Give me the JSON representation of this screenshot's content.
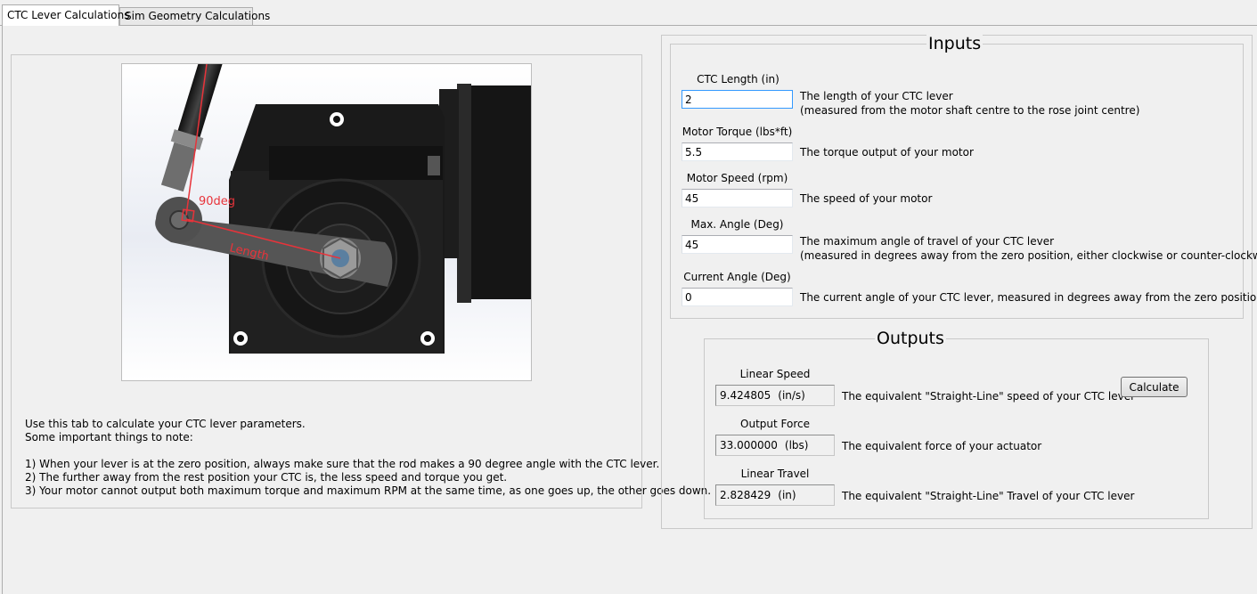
{
  "tabs": [
    {
      "label": "CTC Lever Calculations",
      "active": true
    },
    {
      "label": "Sim Geometry Calculations",
      "active": false
    }
  ],
  "diagram": {
    "angle_label": "90deg",
    "length_label": "Length",
    "annotation_color": "#e8333a"
  },
  "notes": {
    "intro_1": "Use this tab to calculate your CTC lever parameters.",
    "intro_2": "Some important things to note:",
    "point_1": "1) When your lever is at the zero position, always make sure that the rod makes a 90 degree angle with the CTC lever.",
    "point_2": "2) The further away from the rest position your CTC is, the less speed and torque you get.",
    "point_3": "3) Your motor cannot output both maximum torque and maximum RPM at the same time, as one goes up, the other goes down."
  },
  "inputs": {
    "title": "Inputs",
    "fields": [
      {
        "label": "CTC Length (in)",
        "value": "2",
        "desc_1": "The length of your CTC lever",
        "desc_2": "(measured from the motor shaft centre to the rose joint centre)"
      },
      {
        "label": "Motor Torque (lbs*ft)",
        "value": "5.5",
        "desc_1": "The torque output of your motor",
        "desc_2": ""
      },
      {
        "label": "Motor Speed (rpm)",
        "value": "45",
        "desc_1": "The speed of your motor",
        "desc_2": ""
      },
      {
        "label": "Max. Angle (Deg)",
        "value": "45",
        "desc_1": "The maximum angle of travel of your CTC lever",
        "desc_2": "(measured in degrees away from the zero position, either clockwise or counter-clockwise)"
      },
      {
        "label": "Current Angle (Deg)",
        "value": "0",
        "desc_1": "The current angle of your CTC lever, measured in degrees away from the zero position",
        "desc_2": ""
      }
    ]
  },
  "outputs": {
    "title": "Outputs",
    "calculate_label": "Calculate",
    "fields": [
      {
        "label": "Linear Speed",
        "value": "9.424805",
        "unit": "(in/s)",
        "desc": "The equivalent \"Straight-Line\" speed of your CTC lever"
      },
      {
        "label": "Output Force",
        "value": "33.000000",
        "unit": "(lbs)",
        "desc": "The equivalent force of your actuator"
      },
      {
        "label": "Linear Travel",
        "value": "2.828429",
        "unit": "(in)",
        "desc": "The equivalent \"Straight-Line\" Travel of your CTC lever"
      }
    ]
  }
}
